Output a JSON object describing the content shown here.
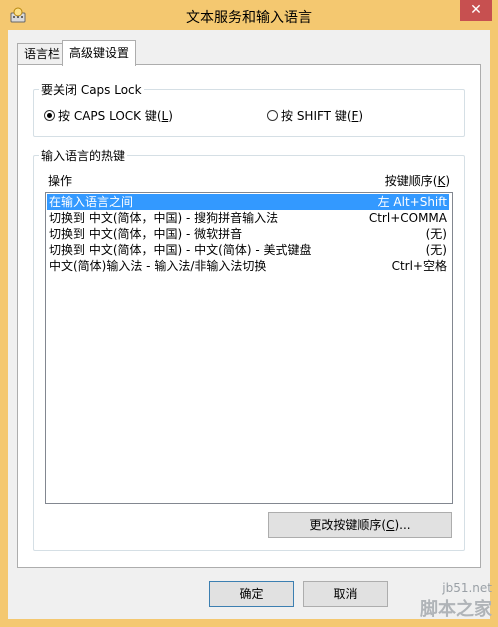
{
  "window": {
    "title": "文本服务和输入语言",
    "close_glyph": "✕",
    "accent_color": "#f4c870"
  },
  "tabs": [
    {
      "label": "语言栏"
    },
    {
      "label": "高级键设置"
    }
  ],
  "caps_lock_group": {
    "title": "要关闭 Caps Lock",
    "options": [
      {
        "prefix": "按 CAPS LOCK 键(",
        "accel": "L",
        "suffix": ")",
        "selected": true
      },
      {
        "prefix": "按 SHIFT 键(",
        "accel": "F",
        "suffix": ")",
        "selected": false
      }
    ]
  },
  "hotkeys_group": {
    "title": "输入语言的热键",
    "col_action": "操作",
    "col_key_prefix": "按键顺序(",
    "col_key_accel": "K",
    "col_key_suffix": ")",
    "rows": [
      {
        "action": "在输入语言之间",
        "key": "左 Alt+Shift",
        "selected": true
      },
      {
        "action": "切换到 中文(简体，中国) - 搜狗拼音输入法",
        "key": "Ctrl+COMMA",
        "selected": false
      },
      {
        "action": "切换到 中文(简体，中国) - 微软拼音",
        "key": "(无)",
        "selected": false
      },
      {
        "action": "切换到 中文(简体，中国) - 中文(简体) - 美式键盘",
        "key": "(无)",
        "selected": false
      },
      {
        "action": "中文(简体)输入法 - 输入法/非输入法切换",
        "key": "Ctrl+空格",
        "selected": false
      }
    ],
    "change_button_prefix": "更改按键顺序(",
    "change_button_accel": "C",
    "change_button_suffix": ")..."
  },
  "footer": {
    "ok_label": "确定",
    "cancel_label": "取消"
  },
  "watermark": {
    "line1": "jb51.net",
    "line2": "脚本之家"
  }
}
